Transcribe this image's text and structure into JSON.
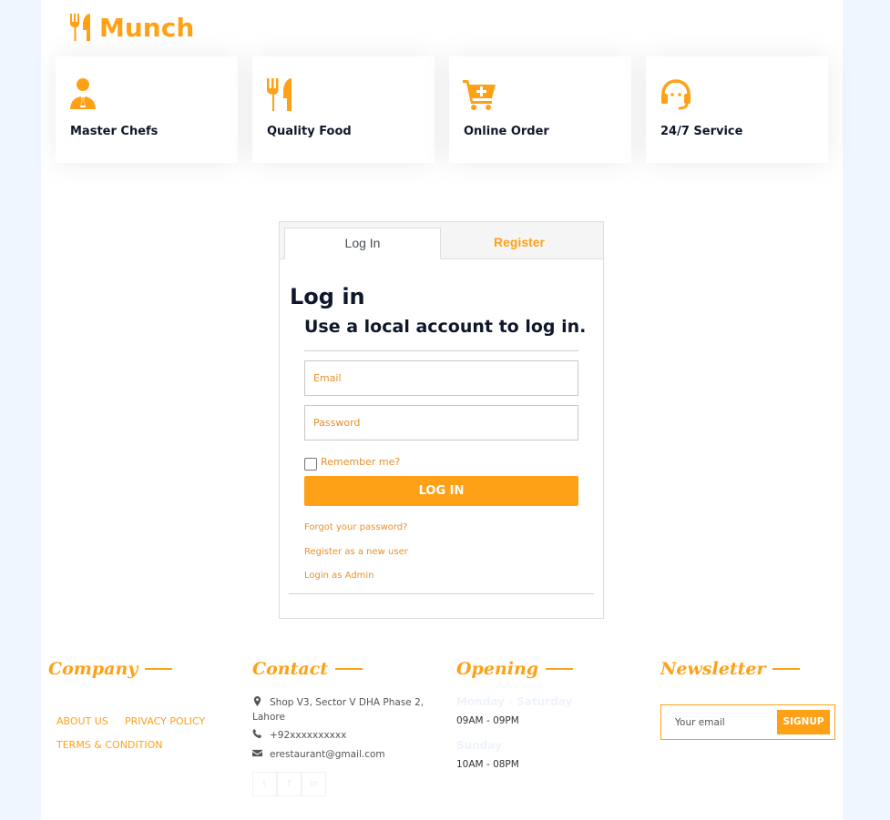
{
  "brand": {
    "name": "Munch",
    "icon": "utensils-icon"
  },
  "colors": {
    "accent": "#fea116",
    "dark": "#0f172b",
    "background": "#f0f6ff"
  },
  "services": [
    {
      "label": "Master Chefs",
      "icon": "chef-icon"
    },
    {
      "label": "Quality Food",
      "icon": "utensils-icon"
    },
    {
      "label": "Online Order",
      "icon": "cart-plus-icon"
    },
    {
      "label": "24/7 Service",
      "icon": "headset-icon"
    }
  ],
  "auth": {
    "tabs": {
      "login": "Log In",
      "register": "Register"
    },
    "title": "Log in",
    "subtitle": "Use a local account to log in.",
    "email_placeholder": "Email",
    "password_placeholder": "Password",
    "remember_label": "Remember me?",
    "submit_label": "LOG IN",
    "links": {
      "forgot": "Forgot your password?",
      "register": "Register as a new user",
      "admin": "Login as Admin"
    }
  },
  "footer": {
    "company": {
      "heading": "Company",
      "links": [
        "ABOUT US",
        "PRIVACY POLICY",
        "TERMS & CONDITION"
      ]
    },
    "contact": {
      "heading": "Contact",
      "address": "Shop V3, Sector V DHA Phase 2, Lahore",
      "phone": "+92xxxxxxxxxx",
      "email": "erestaurant@gmail.com",
      "social": [
        "twitter-icon",
        "facebook-icon",
        "linkedin-icon"
      ]
    },
    "opening": {
      "heading": "Opening",
      "weekday_label": "Monday - Saturday",
      "weekday_hours": "09AM - 09PM",
      "sunday_label": "Sunday",
      "sunday_hours": "10AM - 08PM"
    },
    "newsletter": {
      "heading": "Newsletter",
      "placeholder": "Your email",
      "button": "SIGNUP"
    }
  }
}
